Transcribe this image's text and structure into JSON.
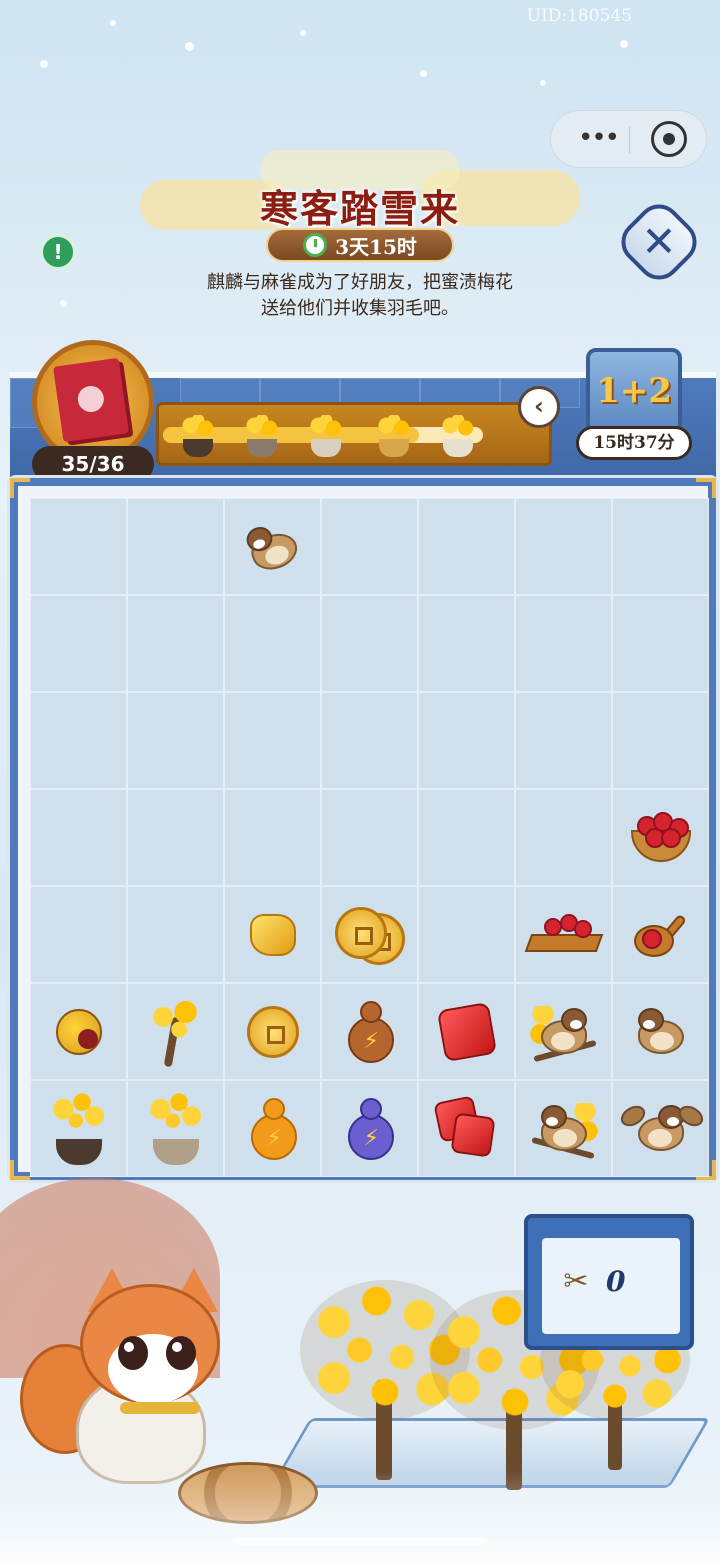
{
  "status": {
    "uid": "UID:180545"
  },
  "event": {
    "title": "寒客踏雪来",
    "time_left": "3天15时",
    "description_line1": "麒麟与麻雀成为了好朋友，把蜜渍梅花",
    "description_line2": "送给他们并收集羽毛吧。"
  },
  "buttons": {
    "info": "!",
    "close": "✕",
    "back": "‹"
  },
  "collection": {
    "count": "35/36",
    "progress": 0.8
  },
  "bonus": {
    "label": "1+2",
    "timer": "15时37分"
  },
  "shears": {
    "count": "0"
  },
  "board": {
    "rows": 7,
    "cols": 7,
    "cells": [
      [
        "",
        "",
        "sparrow-flying-snow",
        "",
        "",
        "",
        ""
      ],
      [
        "",
        "",
        "",
        "",
        "",
        "",
        ""
      ],
      [
        "",
        "",
        "",
        "",
        "",
        "",
        ""
      ],
      [
        "",
        "",
        "",
        "",
        "",
        "",
        "rose-bowl"
      ],
      [
        "",
        "",
        "gold-nugget",
        "coin-stack",
        "",
        "rose-tray",
        "rose-scoop"
      ],
      [
        "plum-bud",
        "plum-branch",
        "copper-coin",
        "brown-energy-gourd",
        "red-gem",
        "sparrow-on-plum-branch",
        "sparrow"
      ],
      [
        "potted-plum",
        "vase-plum",
        "orange-energy-gourd",
        "purple-energy-gourd",
        "red-gem-pair",
        "sparrow-on-plum-perch",
        "sparrow-wings-spread"
      ]
    ]
  },
  "colors": {
    "frame": "#4f7bbd",
    "title": "#8c1d12",
    "gold": "#f4c340"
  }
}
